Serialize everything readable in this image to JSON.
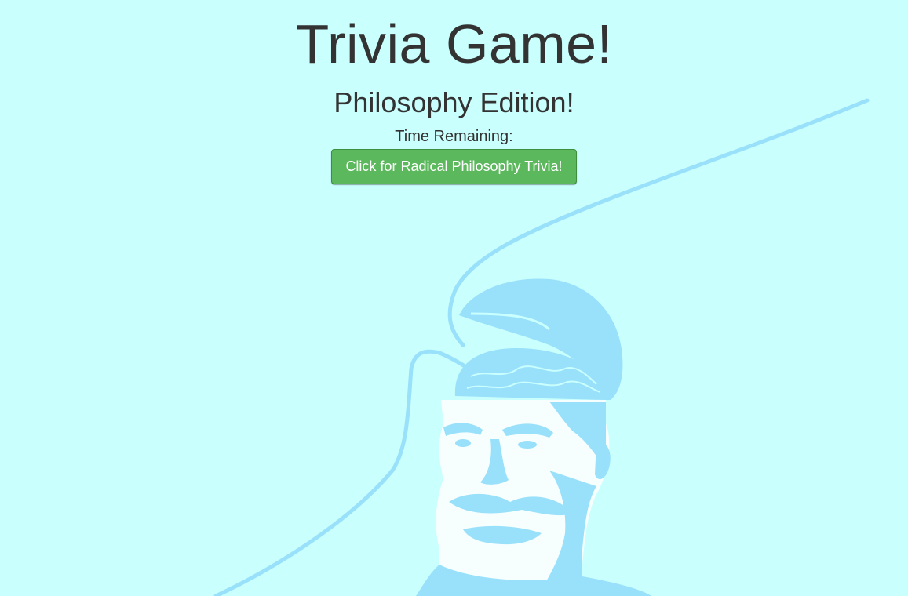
{
  "header": {
    "title": "Trivia Game!",
    "subtitle": "Philosophy Edition!",
    "timer_label": "Time Remaining:",
    "timer_value": ""
  },
  "actions": {
    "start_button_label": "Click for Radical Philosophy Trivia!"
  },
  "colors": {
    "background": "#c9fffd",
    "illustration": "#99e0fb",
    "button": "#5cb85c",
    "text": "#333333"
  },
  "background_image": {
    "subject": "open-head-brain-illustration"
  }
}
